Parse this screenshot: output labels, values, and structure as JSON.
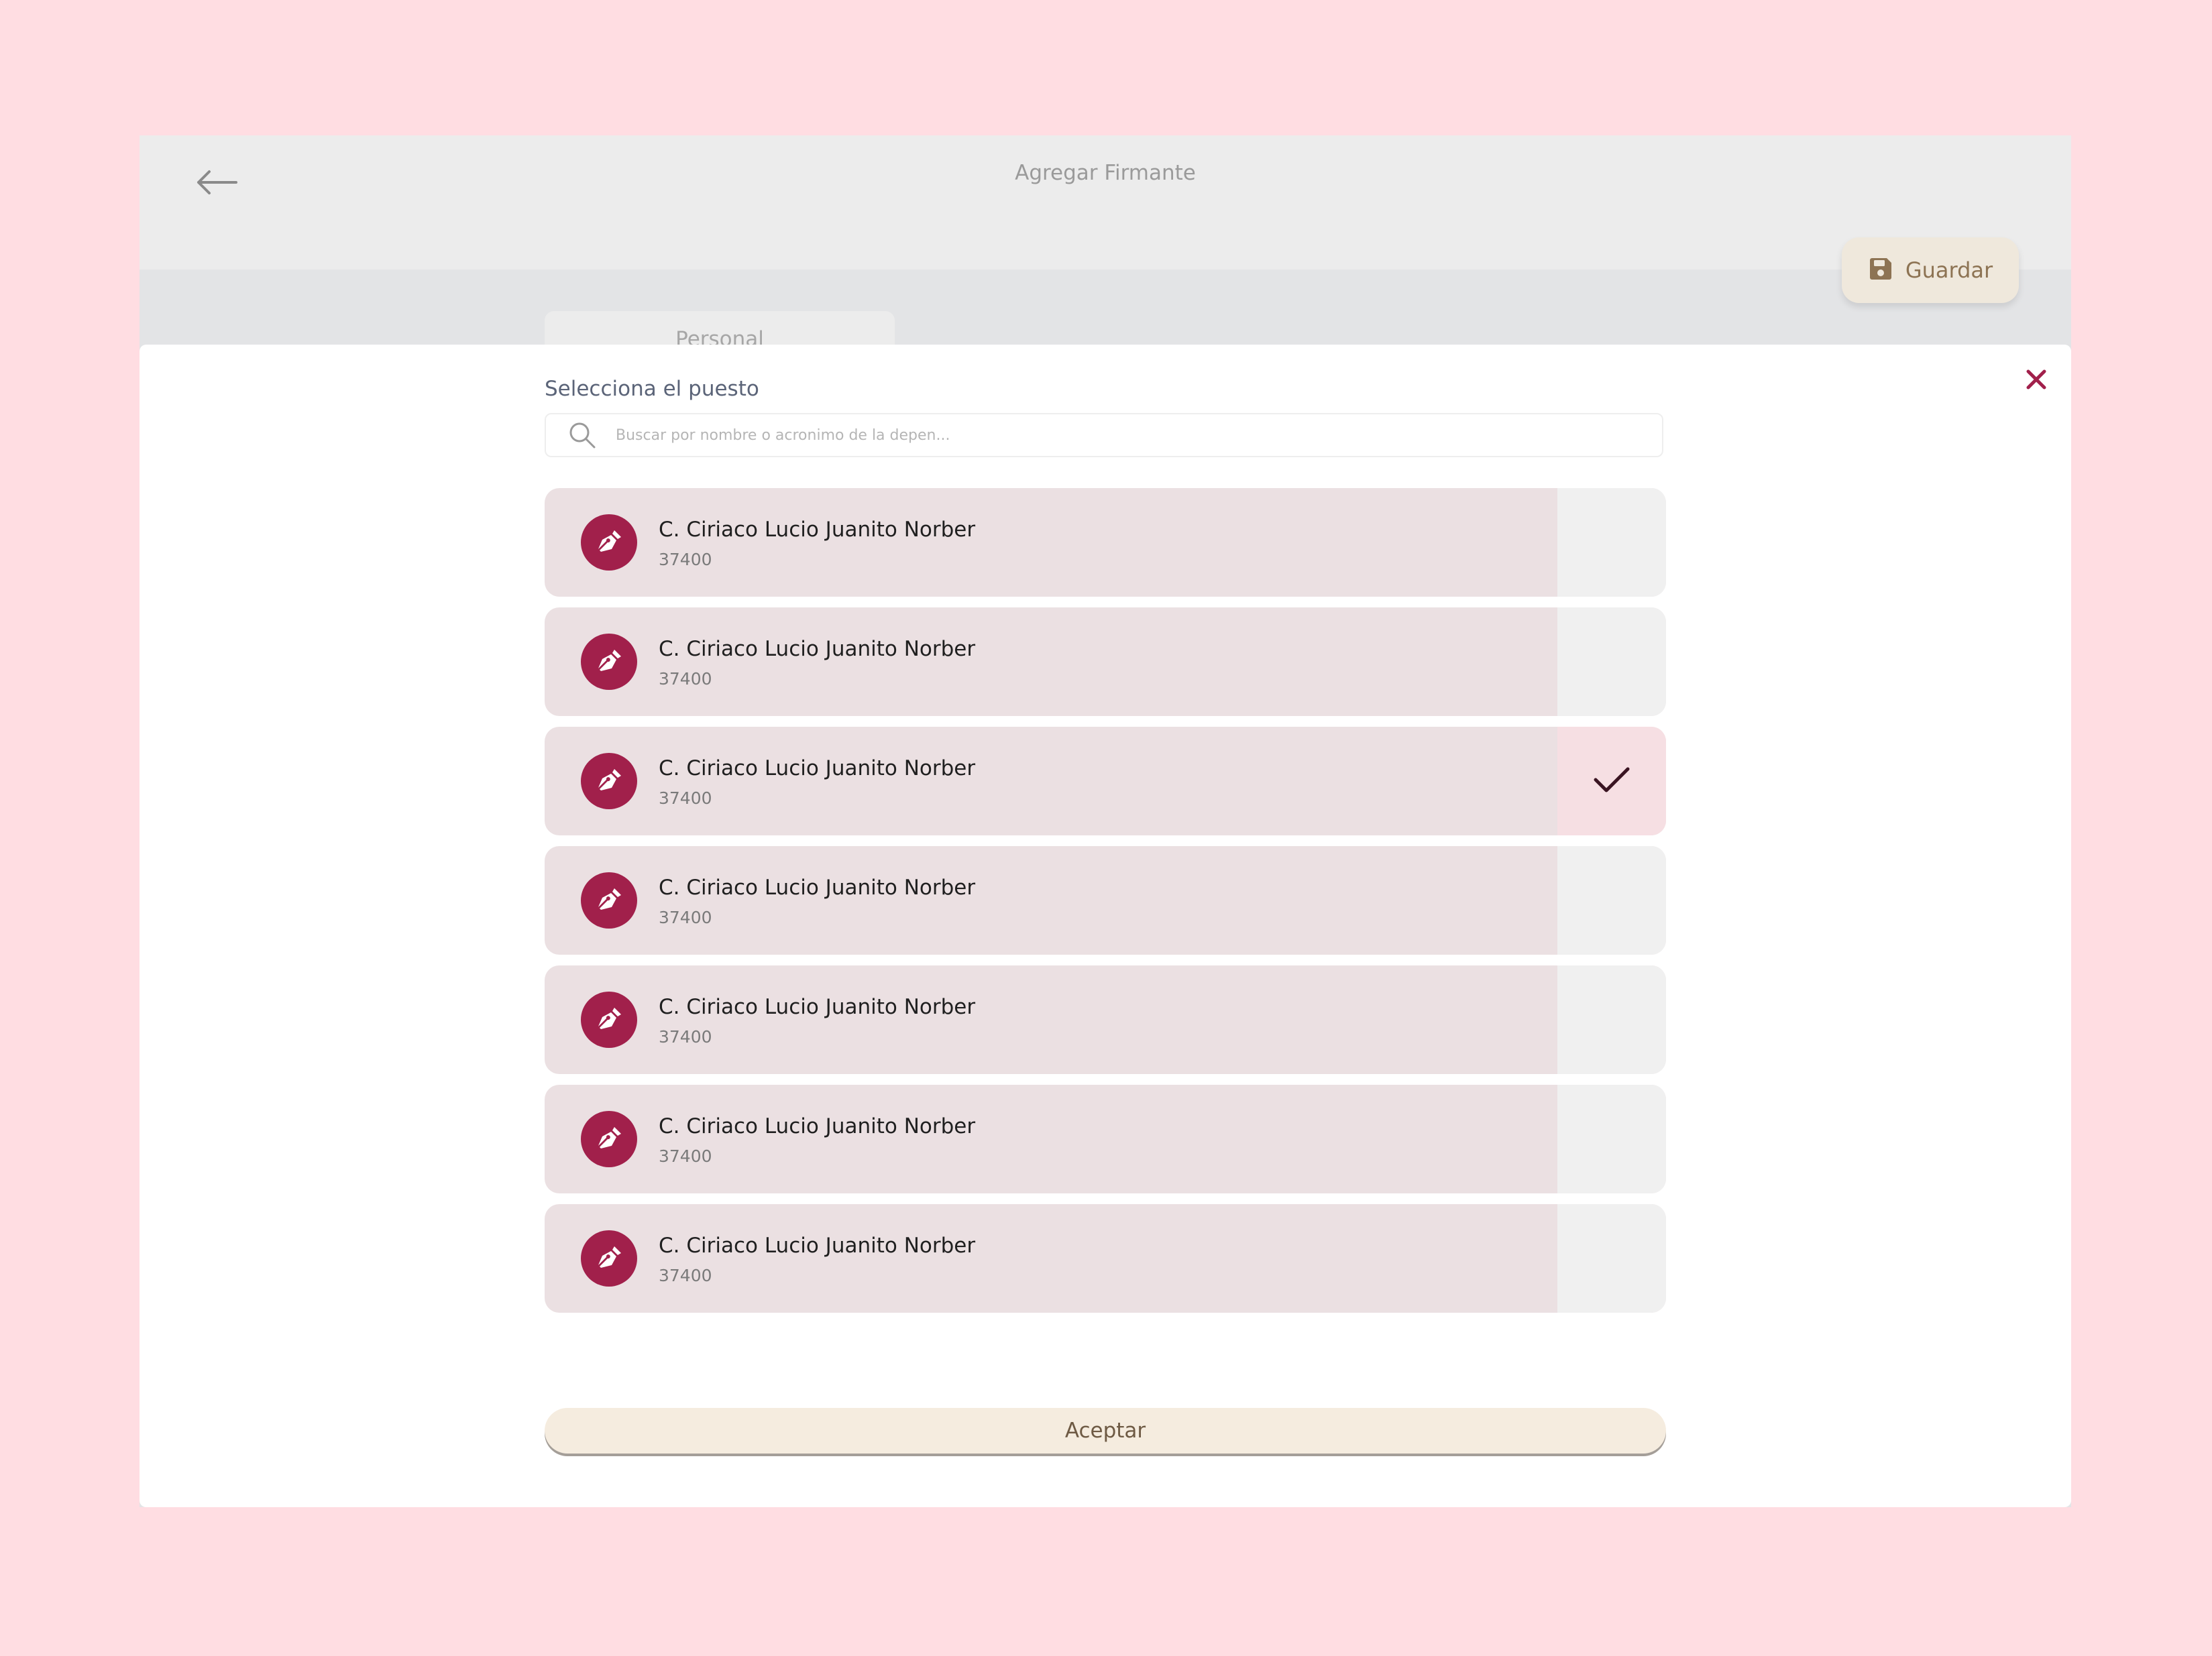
{
  "header": {
    "title": "Agregar Firmante",
    "back_icon": "arrow-left-icon"
  },
  "toolbar": {
    "save_label": "Guardar",
    "save_icon": "floppy-disk-icon"
  },
  "tabs": [
    {
      "label": "Personal"
    }
  ],
  "modal": {
    "heading": "Selecciona el puesto",
    "close_icon": "close-icon",
    "search": {
      "placeholder": "Buscar por nombre o acronimo de la depen...",
      "value": ""
    },
    "items": [
      {
        "name": "C. Ciriaco Lucio Juanito Norber",
        "code": "37400",
        "selected": false,
        "icon": "pen-nib-icon"
      },
      {
        "name": "C. Ciriaco Lucio Juanito Norber",
        "code": "37400",
        "selected": false,
        "icon": "pen-nib-icon"
      },
      {
        "name": "C. Ciriaco Lucio Juanito Norber",
        "code": "37400",
        "selected": true,
        "icon": "pen-nib-icon"
      },
      {
        "name": "C. Ciriaco Lucio Juanito Norber",
        "code": "37400",
        "selected": false,
        "icon": "pen-nib-icon"
      },
      {
        "name": "C. Ciriaco Lucio Juanito Norber",
        "code": "37400",
        "selected": false,
        "icon": "pen-nib-icon"
      },
      {
        "name": "C. Ciriaco Lucio Juanito Norber",
        "code": "37400",
        "selected": false,
        "icon": "pen-nib-icon"
      },
      {
        "name": "C. Ciriaco Lucio Juanito Norber",
        "code": "37400",
        "selected": false,
        "icon": "pen-nib-icon"
      }
    ],
    "accept_label": "Aceptar"
  },
  "colors": {
    "background": "#ffdde2",
    "accent": "#a1204b",
    "save_text": "#8d7353",
    "accept_bg": "#f5ecdf"
  }
}
